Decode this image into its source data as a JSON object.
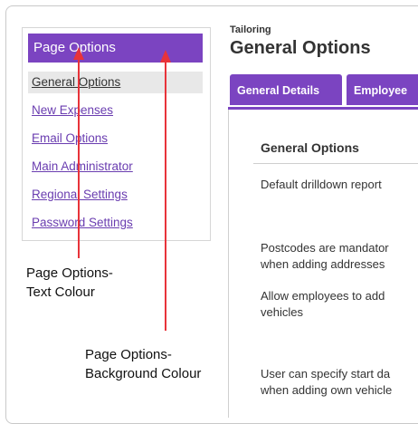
{
  "sidebar": {
    "header": "Page Options",
    "items": [
      {
        "label": "General Options",
        "active": true
      },
      {
        "label": "New Expenses",
        "active": false
      },
      {
        "label": "Email Options",
        "active": false
      },
      {
        "label": "Main Administrator",
        "active": false
      },
      {
        "label": "Regional Settings",
        "active": false
      },
      {
        "label": "Password Settings",
        "active": false
      }
    ]
  },
  "page": {
    "breadcrumb": "Tailoring",
    "title": "General Options"
  },
  "tabs": [
    {
      "label": "General Details"
    },
    {
      "label": "Employee"
    }
  ],
  "content": {
    "heading": "General Options",
    "rows": [
      {
        "line1": "Default drilldown report",
        "line2": ""
      },
      {
        "line1": "Postcodes are mandator",
        "line2": "when adding addresses"
      },
      {
        "line1": "Allow employees to add",
        "line2": "vehicles"
      },
      {
        "line1": "User can specify start da",
        "line2": "when adding own vehicle"
      }
    ]
  },
  "annotations": {
    "text_colour": {
      "line1": "Page Options-",
      "line2": "Text Colour"
    },
    "background_colour": {
      "line1": "Page Options-",
      "line2": "Background Colour"
    }
  },
  "colors": {
    "accent": "#7b44c1",
    "arrow": "#e8333a",
    "link": "#6a3db0"
  }
}
